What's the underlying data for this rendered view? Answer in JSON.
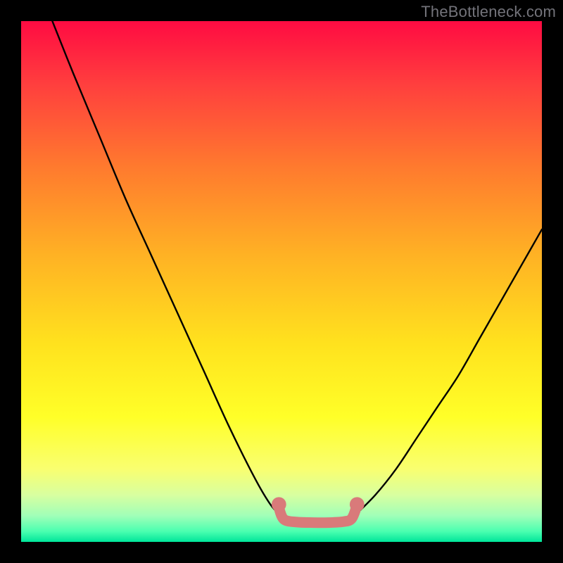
{
  "watermark": "TheBottleneck.com",
  "chart_data": {
    "type": "line",
    "title": "",
    "xlabel": "",
    "ylabel": "",
    "xlim": [
      0,
      100
    ],
    "ylim": [
      0,
      100
    ],
    "series": [
      {
        "name": "left-curve",
        "color": "#000000",
        "x": [
          6,
          10,
          15,
          20,
          25,
          30,
          35,
          40,
          45,
          48,
          50
        ],
        "y": [
          100,
          90,
          78,
          66,
          55,
          44,
          33,
          22,
          12,
          7,
          5
        ]
      },
      {
        "name": "right-curve",
        "color": "#000000",
        "x": [
          64,
          68,
          72,
          76,
          80,
          84,
          88,
          92,
          96,
          100
        ],
        "y": [
          5,
          9,
          14,
          20,
          26,
          32,
          39,
          46,
          53,
          60
        ]
      },
      {
        "name": "bottom-band",
        "color": "#d97a7a",
        "x": [
          49.5,
          50.5,
          53,
          56,
          59,
          62,
          63.5,
          64.5
        ],
        "y": [
          6.5,
          4.3,
          3.8,
          3.7,
          3.7,
          3.9,
          4.5,
          7.0
        ]
      }
    ],
    "markers": [
      {
        "name": "left-dot",
        "color": "#d97a7a",
        "x": 49.5,
        "y": 7.2,
        "r": 1.4
      },
      {
        "name": "right-dot",
        "color": "#d97a7a",
        "x": 64.5,
        "y": 7.2,
        "r": 1.4
      }
    ]
  }
}
